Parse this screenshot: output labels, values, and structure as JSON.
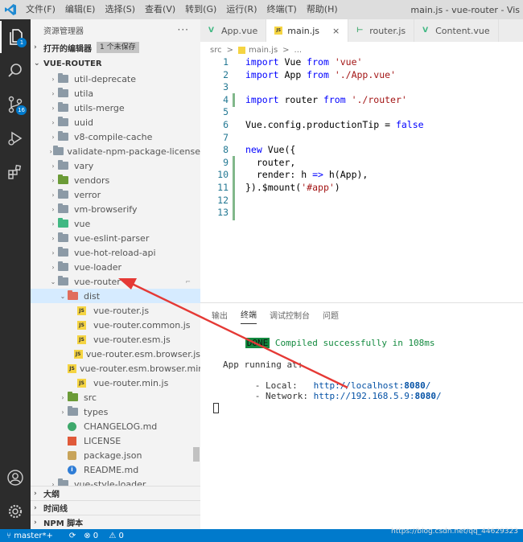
{
  "titlebar": {
    "menu": [
      "文件(F)",
      "编辑(E)",
      "选择(S)",
      "查看(V)",
      "转到(G)",
      "运行(R)",
      "终端(T)",
      "帮助(H)"
    ],
    "title": "main.js - vue-router - Vis"
  },
  "activity": {
    "explorer_badge": "1",
    "scm_badge": "16"
  },
  "sidebar": {
    "title": "资源管理器",
    "more": "···",
    "open_editors_label": "打开的编辑器",
    "unsaved_label": "1 个未保存",
    "project_label": "VUE-ROUTER",
    "tree": [
      {
        "name": "util-deprecate",
        "kind": "folder",
        "depth": 0
      },
      {
        "name": "utila",
        "kind": "folder",
        "depth": 0
      },
      {
        "name": "utils-merge",
        "kind": "folder",
        "depth": 0
      },
      {
        "name": "uuid",
        "kind": "folder",
        "depth": 0
      },
      {
        "name": "v8-compile-cache",
        "kind": "folder",
        "depth": 0
      },
      {
        "name": "validate-npm-package-license",
        "kind": "folder",
        "depth": 0
      },
      {
        "name": "vary",
        "kind": "folder",
        "depth": 0
      },
      {
        "name": "vendors",
        "kind": "folder-green",
        "depth": 0
      },
      {
        "name": "verror",
        "kind": "folder",
        "depth": 0
      },
      {
        "name": "vm-browserify",
        "kind": "folder",
        "depth": 0
      },
      {
        "name": "vue",
        "kind": "folder-vue",
        "depth": 0
      },
      {
        "name": "vue-eslint-parser",
        "kind": "folder",
        "depth": 0
      },
      {
        "name": "vue-hot-reload-api",
        "kind": "folder",
        "depth": 0
      },
      {
        "name": "vue-loader",
        "kind": "folder",
        "depth": 0
      },
      {
        "name": "vue-router",
        "kind": "folder-open",
        "depth": 0
      },
      {
        "name": "dist",
        "kind": "folder-red-open",
        "depth": 1
      },
      {
        "name": "vue-router.js",
        "kind": "js",
        "depth": 2
      },
      {
        "name": "vue-router.common.js",
        "kind": "js",
        "depth": 2
      },
      {
        "name": "vue-router.esm.js",
        "kind": "js",
        "depth": 2
      },
      {
        "name": "vue-router.esm.browser.js",
        "kind": "js",
        "depth": 2
      },
      {
        "name": "vue-router.esm.browser.min.js",
        "kind": "js",
        "depth": 2
      },
      {
        "name": "vue-router.min.js",
        "kind": "js",
        "depth": 2
      },
      {
        "name": "src",
        "kind": "folder-green",
        "depth": 1
      },
      {
        "name": "types",
        "kind": "folder",
        "depth": 1
      },
      {
        "name": "CHANGELOG.md",
        "kind": "changelog",
        "depth": 1
      },
      {
        "name": "LICENSE",
        "kind": "license",
        "depth": 1
      },
      {
        "name": "package.json",
        "kind": "pkg",
        "depth": 1
      },
      {
        "name": "README.md",
        "kind": "readme",
        "depth": 1
      },
      {
        "name": "vue-style-loader",
        "kind": "folder",
        "depth": 0
      }
    ],
    "outline_label": "大纲",
    "timeline_label": "时间线",
    "npm_label": "NPM 脚本"
  },
  "editor": {
    "tabs": [
      {
        "label": "App.vue",
        "icon": "vue-icon",
        "active": false
      },
      {
        "label": "main.js",
        "icon": "js-icon",
        "active": true
      },
      {
        "label": "router.js",
        "icon": "router-icon",
        "active": false
      },
      {
        "label": "Content.vue",
        "icon": "vue-icon",
        "active": false
      }
    ],
    "breadcrumb": [
      "src",
      ">",
      "main.js",
      ">",
      "..."
    ],
    "line_numbers": [
      "1",
      "2",
      "3",
      "4",
      "5",
      "6",
      "7",
      "8",
      "9",
      "10",
      "11",
      "12",
      "13"
    ]
  },
  "panel": {
    "tabs": [
      "输出",
      "终端",
      "调试控制台",
      "问题"
    ],
    "active_tab": "终端",
    "done_label": "DONE",
    "compiled_msg": "Compiled successfully in 108ms",
    "app_running": "App running at:",
    "local_label": "- Local:",
    "local_url": "http://localhost:",
    "local_port": "8080",
    "network_label": "- Network:",
    "network_url": "http://192.168.5.9:",
    "network_port": "8080"
  },
  "status": {
    "branch": "master*+",
    "errors": "0",
    "warnings": "0",
    "watermark": "https://blog.csdn.net/qq_44629323"
  },
  "colors": {
    "activity_bar": "#2c2c2c",
    "status_bar": "#007acc",
    "arrow": "#e53935"
  }
}
